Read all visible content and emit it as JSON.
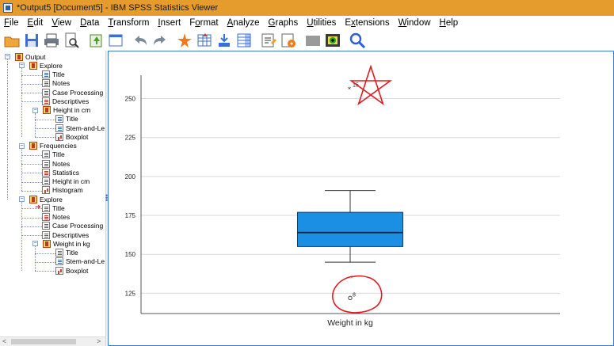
{
  "window": {
    "title": "*Output5 [Document5] - IBM SPSS Statistics Viewer",
    "accent_color": "#e69c2d"
  },
  "menubar": {
    "items": [
      {
        "label": "File",
        "accel": "F",
        "rest": "ile"
      },
      {
        "label": "Edit",
        "accel": "E",
        "rest": "dit"
      },
      {
        "label": "View",
        "accel": "V",
        "rest": "iew"
      },
      {
        "label": "Data",
        "accel": "D",
        "rest": "ata"
      },
      {
        "label": "Transform",
        "accel": "T",
        "rest": "ransform"
      },
      {
        "label": "Insert",
        "accel": "I",
        "rest": "nsert"
      },
      {
        "label": "Format",
        "accel": "o",
        "pre": "F",
        "rest": "rmat"
      },
      {
        "label": "Analyze",
        "accel": "A",
        "rest": "nalyze"
      },
      {
        "label": "Graphs",
        "accel": "G",
        "rest": "raphs"
      },
      {
        "label": "Utilities",
        "accel": "U",
        "rest": "tilities"
      },
      {
        "label": "Extensions",
        "accel": "x",
        "pre": "E",
        "rest": "tensions"
      },
      {
        "label": "Window",
        "accel": "W",
        "rest": "indow"
      },
      {
        "label": "Help",
        "accel": "H",
        "rest": "elp"
      }
    ]
  },
  "toolbar": {
    "buttons": [
      "open-folder-icon",
      "save-icon",
      "print-icon",
      "print-preview-icon",
      "export-icon",
      "recall-dialog-icon",
      "undo-icon",
      "redo-icon",
      "goto-data-icon",
      "goto-case-icon",
      "goto-variable-icon",
      "variables-icon",
      "designate-window-icon",
      "create-edit-autoscript-icon",
      "hide-icon",
      "insert-icon",
      "search-icon"
    ]
  },
  "tree": {
    "nodes": [
      {
        "label": "Output",
        "type": "book",
        "level": 0,
        "expander": "-"
      },
      {
        "label": "Explore",
        "type": "book",
        "level": 1,
        "expander": "-"
      },
      {
        "label": "Title",
        "type": "page",
        "level": 2
      },
      {
        "label": "Notes",
        "type": "page-red",
        "level": 2
      },
      {
        "label": "Case Processing",
        "type": "page-red",
        "level": 2
      },
      {
        "label": "Descriptives",
        "type": "page-red",
        "level": 2
      },
      {
        "label": "Height in cm",
        "type": "book",
        "level": 2,
        "expander": "-"
      },
      {
        "label": "Title",
        "type": "page",
        "level": 3
      },
      {
        "label": "Stem-and-Le",
        "type": "page",
        "level": 3
      },
      {
        "label": "Boxplot",
        "type": "page-chart",
        "level": 3
      },
      {
        "label": "Frequencies",
        "type": "book",
        "level": 1,
        "expander": "-"
      },
      {
        "label": "Title",
        "type": "page",
        "level": 2
      },
      {
        "label": "Notes",
        "type": "page-red",
        "level": 2
      },
      {
        "label": "Statistics",
        "type": "page-red",
        "level": 2
      },
      {
        "label": "Height in cm",
        "type": "page-red",
        "level": 2
      },
      {
        "label": "Histogram",
        "type": "page-chart",
        "level": 2
      },
      {
        "label": "Explore",
        "type": "book",
        "level": 1,
        "expander": "-"
      },
      {
        "label": "Title",
        "type": "page",
        "level": 2,
        "marker": true
      },
      {
        "label": "Notes",
        "type": "page-red",
        "level": 2
      },
      {
        "label": "Case Processing",
        "type": "page-red",
        "level": 2
      },
      {
        "label": "Descriptives",
        "type": "page-red",
        "level": 2
      },
      {
        "label": "Weight in kg",
        "type": "book",
        "level": 2,
        "expander": "-"
      },
      {
        "label": "Title",
        "type": "page",
        "level": 3
      },
      {
        "label": "Stem-and-Le",
        "type": "page",
        "level": 3
      },
      {
        "label": "Boxplot",
        "type": "page-chart",
        "level": 3
      }
    ]
  },
  "chart_data": {
    "type": "boxplot",
    "xlabel": "Weight in kg",
    "ylabel": "",
    "yticks": [
      125,
      150,
      175,
      200,
      225,
      250
    ],
    "ylim": [
      112,
      265
    ],
    "grid": true,
    "box": {
      "whisker_low": 145,
      "q1": 155,
      "median": 164,
      "q3": 177,
      "whisker_high": 191,
      "fill_color": "#1a8fe3"
    },
    "outliers": [
      {
        "value": 122,
        "label": "8",
        "marker": "circle"
      }
    ],
    "extremes": [
      {
        "value": 256,
        "label": "15",
        "marker": "star"
      }
    ],
    "annotations": {
      "star_shape_color": "#e01a22",
      "circle_shape_color": "#e01a22"
    }
  }
}
